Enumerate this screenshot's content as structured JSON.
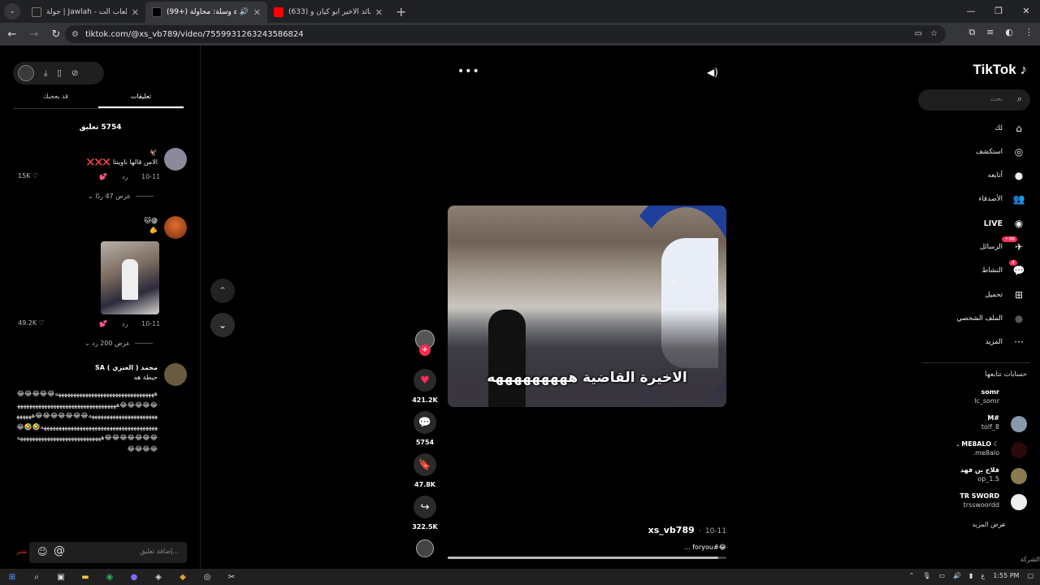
{
  "browser": {
    "tabs": [
      {
        "title": "جولة | Jawlah - منصة الألعاب الت...",
        "favicon_color": "#1a1a1a",
        "active": false
      },
      {
        "title": "(99+) فقرة كرة وسلة: محاولة...",
        "favicon_color": "#000000",
        "active": true,
        "audio": "🔊"
      },
      {
        "title": "(633) اغنية القائد الاخير ابو كيان و...",
        "favicon_color": "#ff0000",
        "active": false
      }
    ],
    "new_tab": "+",
    "url": "tiktok.com/@xs_vb789/video/7559931263243586824",
    "window_controls": [
      "—",
      "❐",
      "✕"
    ]
  },
  "comments_panel": {
    "tabs": [
      "تعليقات",
      "قد يعجبك"
    ],
    "count_label": "5754 تعليق",
    "comments": [
      {
        "user": "🦅",
        "text": "الامن قالها ناوينتا ❌❌❌",
        "date": "10-11",
        "reply": "رد",
        "likes": "15K",
        "view_replies": "عرض 47 ردًا",
        "avatar_color": "#8a8a9a"
      },
      {
        "user": "@🐱",
        "text": "🫵",
        "date": "10-11",
        "reply": "رد",
        "likes": "49.2K",
        "view_replies": "عرض 200 رد",
        "avatar_color": "#c0501c"
      },
      {
        "user": "محمد ( العنزي ) SA",
        "text": "حيطة هه",
        "avatar_color": "#6a5a40"
      }
    ],
    "spam_text": "هههههههههههههههههههههههههههههههههه😂😂😂😂😂😂😂😂😂😂ههههههههههههههههههههههههههههههههههههههههههههههههههههههههه😂😂😂😂😂😂😂ههههههههههههههههههههههههههههههههههههههههههههه🤣🤣😂😂😂😂😂😂😂😂ههههههههههههههههههههههههههههه😂😂😂😂",
    "input_placeholder": "إضافة تعليق...",
    "post_label": "نشر"
  },
  "player": {
    "caption": "الاخيرة القاضية هههههههههه",
    "author": "xs_vb789",
    "date": "10-11",
    "description": "😂#foryou ...",
    "progress": 0.97,
    "likes": "421.2K",
    "comments": "5754",
    "saves": "47.8K",
    "shares": "322.5K"
  },
  "right_nav": {
    "logo": "TikTok",
    "search_placeholder": "بحث",
    "items": [
      {
        "label": "لك",
        "icon": "⌂"
      },
      {
        "label": "استكشف",
        "icon": "◎"
      },
      {
        "label": "أتابعه",
        "icon": "●"
      },
      {
        "label": "الأصدقاء",
        "icon": "👥"
      },
      {
        "label": "LIVE",
        "icon": "◉"
      },
      {
        "label": "الرسائل",
        "icon": "✈",
        "badge": "99+"
      },
      {
        "label": "النشاط",
        "icon": "💬",
        "badge": "4"
      },
      {
        "label": "تحميل",
        "icon": "⊞"
      },
      {
        "label": "الملف الشخصي",
        "icon": "●"
      },
      {
        "label": "المزيد",
        "icon": "···"
      }
    ],
    "following_title": "حسابات تتابعها",
    "following": [
      {
        "name": "somr",
        "handle": "lc_somr",
        "color": "#000000"
      },
      {
        "name": "#M",
        "handle": "tolf_8",
        "color": "#8899aa"
      },
      {
        "name": "☾ ME8ALO .",
        "handle": "me8alo.",
        "color": "#2a0a0a"
      },
      {
        "name": "فلاح بن فهد",
        "handle": "op_1.5",
        "color": "#8a7a50"
      },
      {
        "name": "TR SWORD",
        "handle": "trsswoordd",
        "color": "#eeeeee"
      }
    ],
    "see_more": "عرض المزيد",
    "company": "الشركة"
  },
  "taskbar": {
    "time": "1:55 PM",
    "lang": "ع"
  }
}
